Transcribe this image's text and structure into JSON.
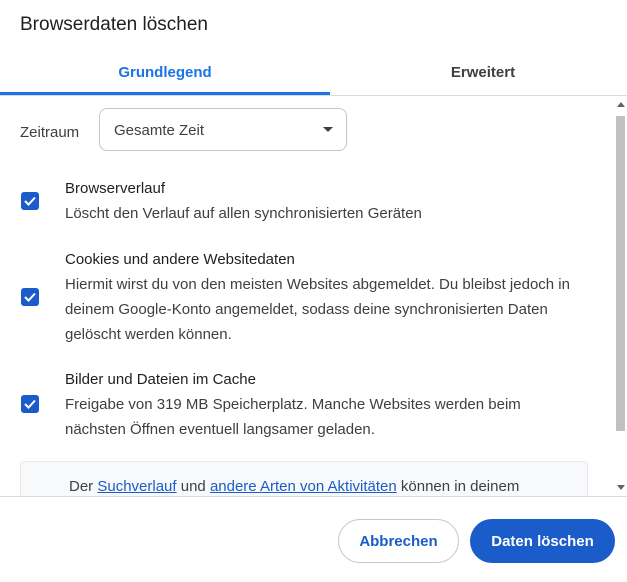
{
  "dialog": {
    "title": "Browserdaten löschen"
  },
  "tabs": [
    {
      "label": "Grundlegend",
      "selected": true
    },
    {
      "label": "Erweitert",
      "selected": false
    }
  ],
  "time_range": {
    "label": "Zeitraum",
    "value": "Gesamte Zeit"
  },
  "options": [
    {
      "title": "Browserverlauf",
      "description": "Löscht den Verlauf auf allen synchronisierten Geräten",
      "checked": true
    },
    {
      "title": "Cookies und andere Websitedaten",
      "description": "Hiermit wirst du von den meisten Websites abgemeldet. Du bleibst jedoch in deinem Google-Konto angemeldet, sodass deine synchronisierten Daten gelöscht werden können.",
      "checked": true
    },
    {
      "title": "Bilder und Dateien im Cache",
      "description": "Freigabe von 319 MB Speicherplatz. Manche Websites werden beim nächsten Öffnen eventuell langsamer geladen.",
      "checked": true
    }
  ],
  "info": {
    "prefix": "Der ",
    "link1": "Suchverlauf",
    "middle": " und ",
    "link2": "andere Arten von Aktivitäten",
    "suffix": " können in deinem"
  },
  "footer": {
    "cancel_label": "Abbrechen",
    "delete_label": "Daten löschen"
  },
  "colors": {
    "accent": "#1a73e8",
    "button_primary": "#1a5cc9",
    "checkbox": "#1a5cc9"
  },
  "icons": {
    "checkbox_checked": "checkmark-icon",
    "dropdown": "caret-down-icon"
  }
}
